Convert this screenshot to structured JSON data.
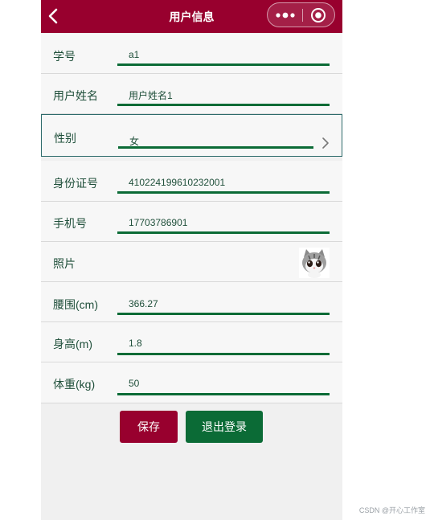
{
  "navbar": {
    "title": "用户信息",
    "back_icon": "chevron-left-icon",
    "more_icon": "more-dots-icon",
    "close_icon": "target-close-icon"
  },
  "fields": {
    "student_id": {
      "label": "学号",
      "value": "a1"
    },
    "name": {
      "label": "用户姓名",
      "value": "用户姓名1"
    },
    "gender": {
      "label": "性别",
      "value": "女",
      "icon": "chevron-right-icon"
    },
    "id_card": {
      "label": "身份证号",
      "value": "410224199610232001"
    },
    "phone": {
      "label": "手机号",
      "value": "17703786901"
    },
    "photo": {
      "label": "照片",
      "icon": "cat-avatar-icon"
    },
    "waist": {
      "label": "腰围(cm)",
      "value": "366.27"
    },
    "height": {
      "label": "身高(m)",
      "value": "1.8"
    },
    "weight": {
      "label": "体重(kg)",
      "value": "50"
    }
  },
  "buttons": {
    "save": "保存",
    "logout": "退出登录"
  },
  "watermark": "CSDN @开心工作室",
  "colors": {
    "brand_red": "#98002e",
    "brand_green": "#0b6b36"
  }
}
